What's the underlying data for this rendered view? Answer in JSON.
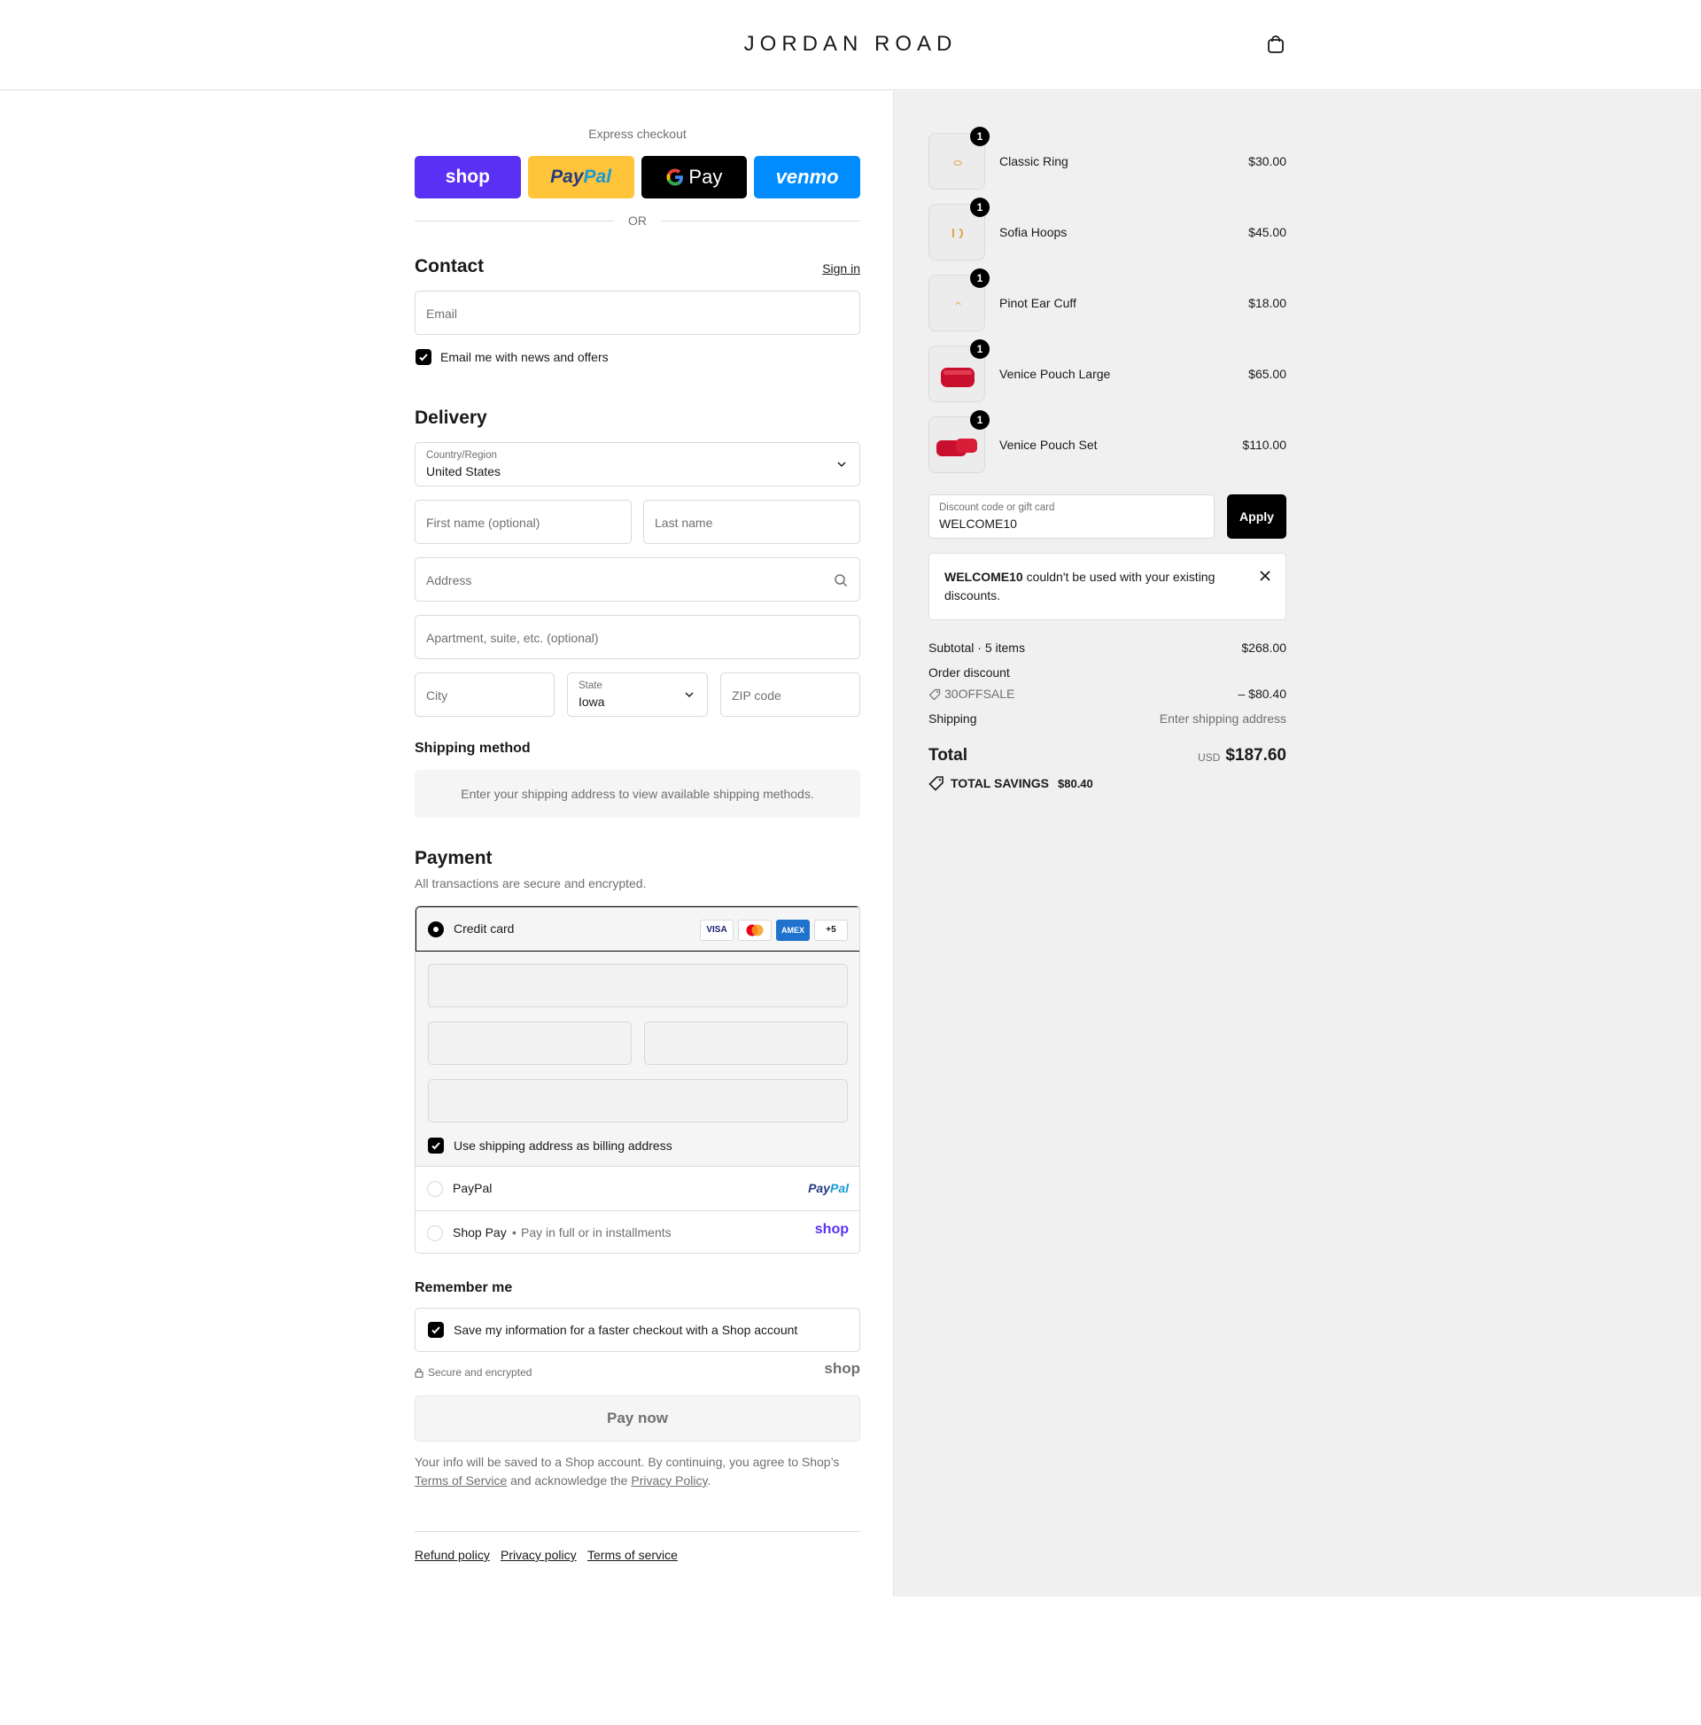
{
  "header": {
    "logo": "JORDAN ROAD",
    "cart_icon": "bag-icon"
  },
  "express": {
    "title": "Express checkout",
    "buttons": [
      "shop",
      "PayPal",
      "G Pay",
      "venmo"
    ],
    "or": "OR"
  },
  "contact": {
    "title": "Contact",
    "signin": "Sign in",
    "email_placeholder": "Email",
    "news_label": "Email me with news and offers"
  },
  "delivery": {
    "title": "Delivery",
    "country_label": "Country/Region",
    "country_value": "United States",
    "first_name": "First name (optional)",
    "last_name": "Last name",
    "address": "Address",
    "apartment": "Apartment, suite, etc. (optional)",
    "city": "City",
    "state_label": "State",
    "state_value": "Iowa",
    "zip": "ZIP code"
  },
  "shipping": {
    "title": "Shipping method",
    "message": "Enter your shipping address to view available shipping methods."
  },
  "payment": {
    "title": "Payment",
    "subtitle": "All transactions are secure and encrypted.",
    "credit_card": "Credit card",
    "card_logos": [
      "VISA",
      "MC",
      "AMEX",
      "+5"
    ],
    "billing_label": "Use shipping address as billing address",
    "paypal": "PayPal",
    "paypal_logo": "PayPal",
    "shop_pay": "Shop Pay",
    "shop_pay_note": "Pay in full or in installments",
    "shop_logo": "shop"
  },
  "remember": {
    "title": "Remember me",
    "save_label": "Save my information for a faster checkout with a Shop account",
    "secure": "Secure and encrypted",
    "shop_logo": "shop"
  },
  "pay_now": "Pay now",
  "legal": {
    "text1": "Your info will be saved to a Shop account. By continuing, you agree to Shop’s",
    "tos": "Terms of Service",
    "text2": "and acknowledge the",
    "privacy": "Privacy Policy",
    "end": "."
  },
  "footer": [
    "Refund policy",
    "Privacy policy",
    "Terms of service"
  ],
  "cart": {
    "items": [
      {
        "name": "Classic Ring",
        "price": "$30.00",
        "qty": "1"
      },
      {
        "name": "Sofia Hoops",
        "price": "$45.00",
        "qty": "1"
      },
      {
        "name": "Pinot Ear Cuff",
        "price": "$18.00",
        "qty": "1"
      },
      {
        "name": "Venice Pouch Large",
        "price": "$65.00",
        "qty": "1"
      },
      {
        "name": "Venice Pouch Set",
        "price": "$110.00",
        "qty": "1"
      }
    ],
    "discount_label": "Discount code or gift card",
    "discount_value": "WELCOME10",
    "apply": "Apply",
    "warning_code": "WELCOME10",
    "warning_text": "couldn't be used with your existing discounts.",
    "subtotal_label": "Subtotal · 5 items",
    "subtotal": "$268.00",
    "order_discount": "Order discount",
    "discount_code": "30OFFSALE",
    "discount_amount": "– $80.40",
    "shipping_label": "Shipping",
    "shipping_value": "Enter shipping address",
    "total_label": "Total",
    "currency": "USD",
    "total": "$187.60",
    "savings_label": "TOTAL SAVINGS",
    "savings": "$80.40"
  },
  "colors": {
    "shop_purple": "#5a31f4",
    "paypal_yellow": "#ffc439",
    "venmo_blue": "#008cff"
  }
}
